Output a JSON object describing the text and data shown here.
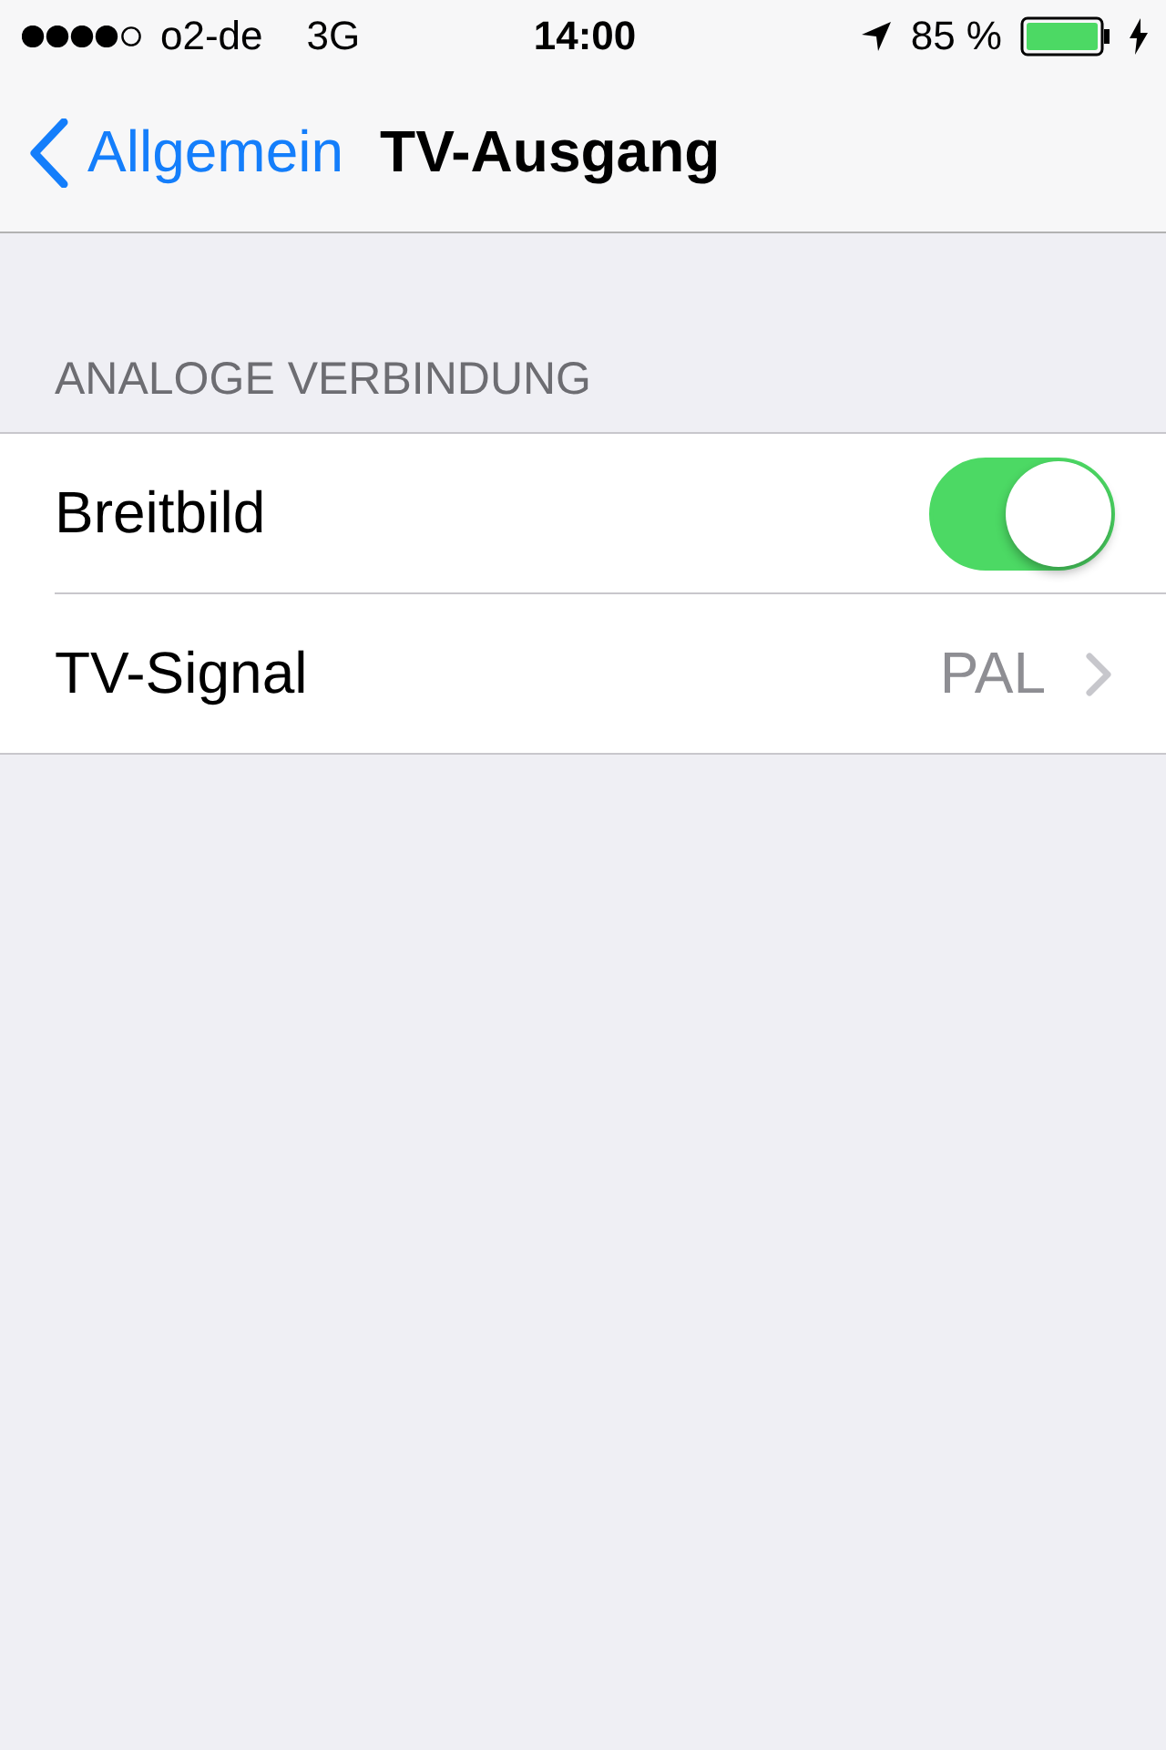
{
  "status_bar": {
    "carrier": "o2-de",
    "network": "3G",
    "time": "14:00",
    "battery": "85 %"
  },
  "nav": {
    "back": "Allgemein",
    "title": "TV-Ausgang"
  },
  "section": {
    "header": "ANALOGE VERBINDUNG",
    "rows": [
      {
        "kind": "toggle",
        "label": "Breitbild",
        "on": true
      },
      {
        "kind": "disclosure",
        "label": "TV-Signal",
        "value": "PAL"
      }
    ]
  }
}
